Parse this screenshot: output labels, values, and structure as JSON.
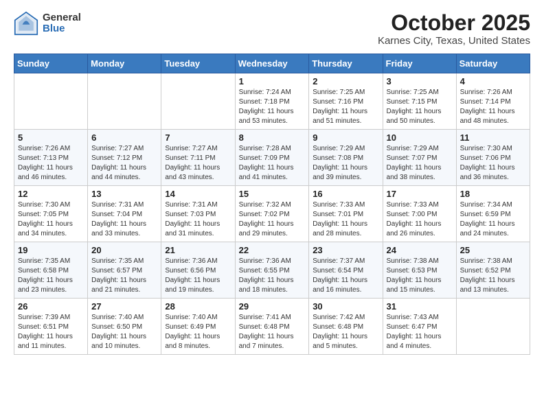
{
  "header": {
    "logo": {
      "general": "General",
      "blue": "Blue"
    },
    "title": "October 2025",
    "subtitle": "Karnes City, Texas, United States"
  },
  "days_of_week": [
    "Sunday",
    "Monday",
    "Tuesday",
    "Wednesday",
    "Thursday",
    "Friday",
    "Saturday"
  ],
  "weeks": [
    [
      {
        "day": "",
        "info": ""
      },
      {
        "day": "",
        "info": ""
      },
      {
        "day": "",
        "info": ""
      },
      {
        "day": "1",
        "info": "Sunrise: 7:24 AM\nSunset: 7:18 PM\nDaylight: 11 hours\nand 53 minutes."
      },
      {
        "day": "2",
        "info": "Sunrise: 7:25 AM\nSunset: 7:16 PM\nDaylight: 11 hours\nand 51 minutes."
      },
      {
        "day": "3",
        "info": "Sunrise: 7:25 AM\nSunset: 7:15 PM\nDaylight: 11 hours\nand 50 minutes."
      },
      {
        "day": "4",
        "info": "Sunrise: 7:26 AM\nSunset: 7:14 PM\nDaylight: 11 hours\nand 48 minutes."
      }
    ],
    [
      {
        "day": "5",
        "info": "Sunrise: 7:26 AM\nSunset: 7:13 PM\nDaylight: 11 hours\nand 46 minutes."
      },
      {
        "day": "6",
        "info": "Sunrise: 7:27 AM\nSunset: 7:12 PM\nDaylight: 11 hours\nand 44 minutes."
      },
      {
        "day": "7",
        "info": "Sunrise: 7:27 AM\nSunset: 7:11 PM\nDaylight: 11 hours\nand 43 minutes."
      },
      {
        "day": "8",
        "info": "Sunrise: 7:28 AM\nSunset: 7:09 PM\nDaylight: 11 hours\nand 41 minutes."
      },
      {
        "day": "9",
        "info": "Sunrise: 7:29 AM\nSunset: 7:08 PM\nDaylight: 11 hours\nand 39 minutes."
      },
      {
        "day": "10",
        "info": "Sunrise: 7:29 AM\nSunset: 7:07 PM\nDaylight: 11 hours\nand 38 minutes."
      },
      {
        "day": "11",
        "info": "Sunrise: 7:30 AM\nSunset: 7:06 PM\nDaylight: 11 hours\nand 36 minutes."
      }
    ],
    [
      {
        "day": "12",
        "info": "Sunrise: 7:30 AM\nSunset: 7:05 PM\nDaylight: 11 hours\nand 34 minutes."
      },
      {
        "day": "13",
        "info": "Sunrise: 7:31 AM\nSunset: 7:04 PM\nDaylight: 11 hours\nand 33 minutes."
      },
      {
        "day": "14",
        "info": "Sunrise: 7:31 AM\nSunset: 7:03 PM\nDaylight: 11 hours\nand 31 minutes."
      },
      {
        "day": "15",
        "info": "Sunrise: 7:32 AM\nSunset: 7:02 PM\nDaylight: 11 hours\nand 29 minutes."
      },
      {
        "day": "16",
        "info": "Sunrise: 7:33 AM\nSunset: 7:01 PM\nDaylight: 11 hours\nand 28 minutes."
      },
      {
        "day": "17",
        "info": "Sunrise: 7:33 AM\nSunset: 7:00 PM\nDaylight: 11 hours\nand 26 minutes."
      },
      {
        "day": "18",
        "info": "Sunrise: 7:34 AM\nSunset: 6:59 PM\nDaylight: 11 hours\nand 24 minutes."
      }
    ],
    [
      {
        "day": "19",
        "info": "Sunrise: 7:35 AM\nSunset: 6:58 PM\nDaylight: 11 hours\nand 23 minutes."
      },
      {
        "day": "20",
        "info": "Sunrise: 7:35 AM\nSunset: 6:57 PM\nDaylight: 11 hours\nand 21 minutes."
      },
      {
        "day": "21",
        "info": "Sunrise: 7:36 AM\nSunset: 6:56 PM\nDaylight: 11 hours\nand 19 minutes."
      },
      {
        "day": "22",
        "info": "Sunrise: 7:36 AM\nSunset: 6:55 PM\nDaylight: 11 hours\nand 18 minutes."
      },
      {
        "day": "23",
        "info": "Sunrise: 7:37 AM\nSunset: 6:54 PM\nDaylight: 11 hours\nand 16 minutes."
      },
      {
        "day": "24",
        "info": "Sunrise: 7:38 AM\nSunset: 6:53 PM\nDaylight: 11 hours\nand 15 minutes."
      },
      {
        "day": "25",
        "info": "Sunrise: 7:38 AM\nSunset: 6:52 PM\nDaylight: 11 hours\nand 13 minutes."
      }
    ],
    [
      {
        "day": "26",
        "info": "Sunrise: 7:39 AM\nSunset: 6:51 PM\nDaylight: 11 hours\nand 11 minutes."
      },
      {
        "day": "27",
        "info": "Sunrise: 7:40 AM\nSunset: 6:50 PM\nDaylight: 11 hours\nand 10 minutes."
      },
      {
        "day": "28",
        "info": "Sunrise: 7:40 AM\nSunset: 6:49 PM\nDaylight: 11 hours\nand 8 minutes."
      },
      {
        "day": "29",
        "info": "Sunrise: 7:41 AM\nSunset: 6:48 PM\nDaylight: 11 hours\nand 7 minutes."
      },
      {
        "day": "30",
        "info": "Sunrise: 7:42 AM\nSunset: 6:48 PM\nDaylight: 11 hours\nand 5 minutes."
      },
      {
        "day": "31",
        "info": "Sunrise: 7:43 AM\nSunset: 6:47 PM\nDaylight: 11 hours\nand 4 minutes."
      },
      {
        "day": "",
        "info": ""
      }
    ]
  ]
}
